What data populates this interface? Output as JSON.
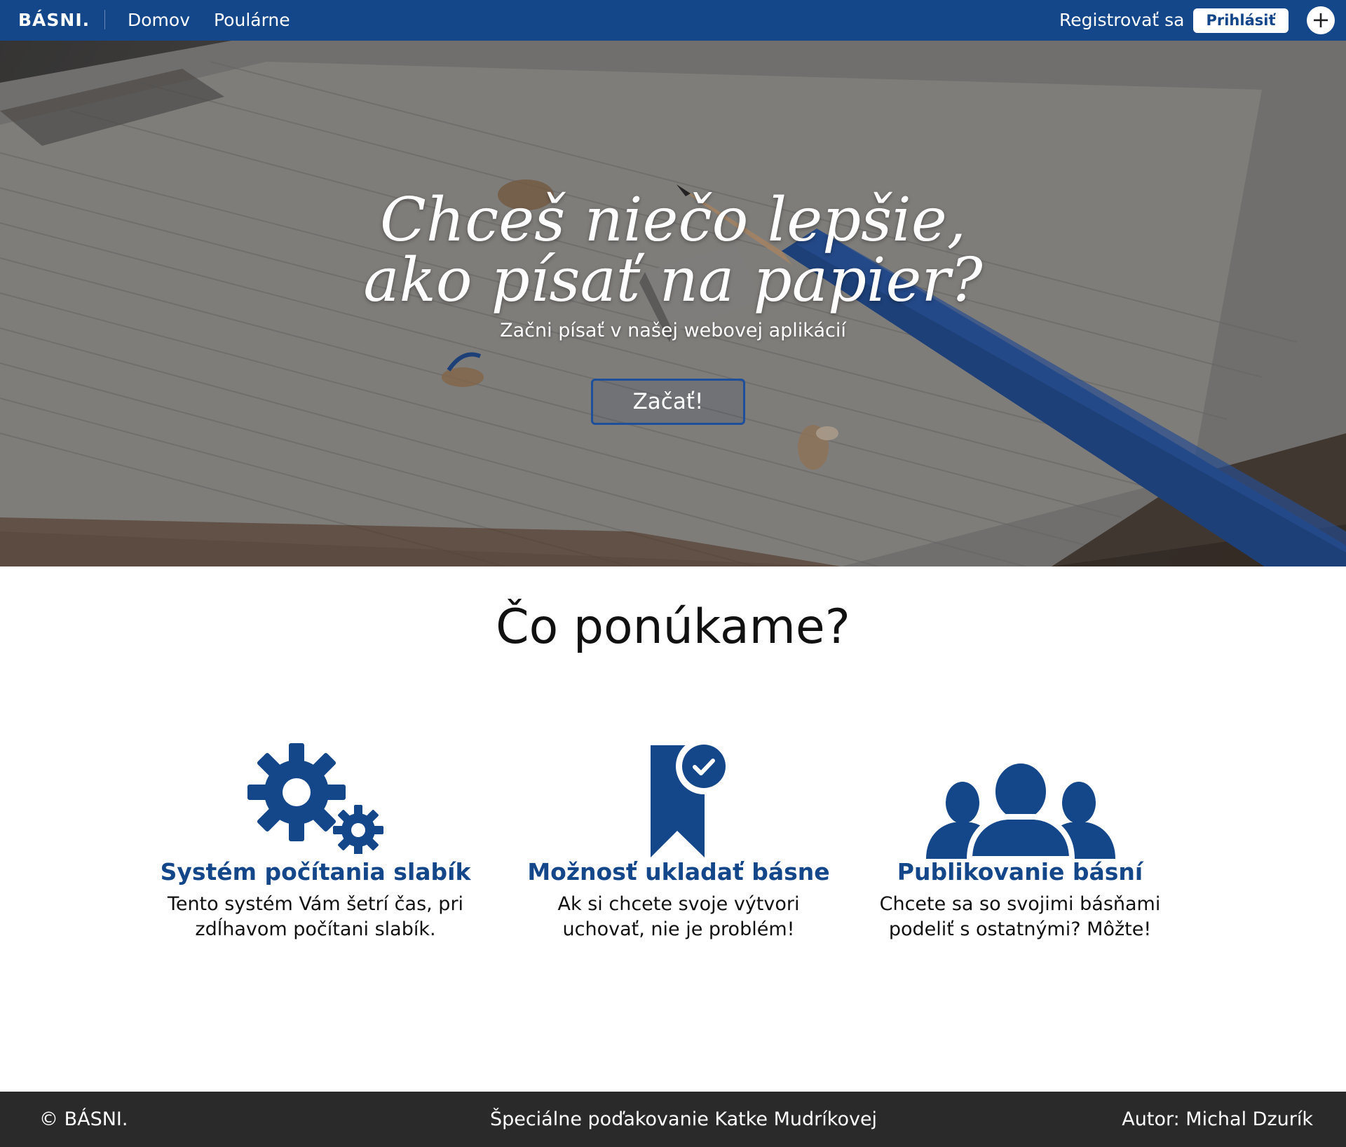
{
  "navbar": {
    "brand": "BÁSNI.",
    "links": [
      "Domov",
      "Poulárne"
    ],
    "register": "Registrovať sa",
    "login": "Prihlásiť",
    "add": "+"
  },
  "hero": {
    "title_line1": "Chceš niečo lepšie,",
    "title_line2": "ako písať na papier?",
    "subtitle": "Začni písať v našej webovej aplikácií",
    "cta": "Začať!"
  },
  "offer": {
    "title": "Čo ponúkame?",
    "features": [
      {
        "icon": "gears-icon",
        "title": "Systém počítania slabík",
        "desc_line1": "Tento systém Vám šetrí čas, pri",
        "desc_line2": "zdĺhavom počítani slabík."
      },
      {
        "icon": "bookmark-check-icon",
        "title": "Možnosť ukladať básne",
        "desc_line1": "Ak si chcete svoje výtvori",
        "desc_line2": "uchovať, nie je problém!"
      },
      {
        "icon": "users-icon",
        "title": "Publikovanie básní",
        "desc_line1": "Chcete sa so svojimi básňami",
        "desc_line2": "podeliť s ostatnými? Môžte!"
      }
    ]
  },
  "footer": {
    "copyright": "© BÁSNI.",
    "thanks": "Špeciálne poďakovanie Katke Mudríkovej",
    "author": "Autor: Michal Dzurík"
  },
  "colors": {
    "primary": "#14478a",
    "footer_bg": "#2a2a2a"
  }
}
